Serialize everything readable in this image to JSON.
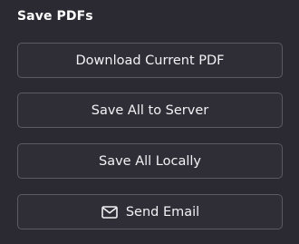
{
  "section": {
    "title": "Save PDFs"
  },
  "buttons": {
    "download_current": "Download Current PDF",
    "save_all_server": "Save All to Server",
    "save_all_locally": "Save All Locally",
    "send_email": "Send Email"
  },
  "icons": {
    "send_email": "mail-icon"
  },
  "colors": {
    "background": "#2b2a33",
    "button_border": "#5b5a63",
    "text": "#ffffff"
  }
}
